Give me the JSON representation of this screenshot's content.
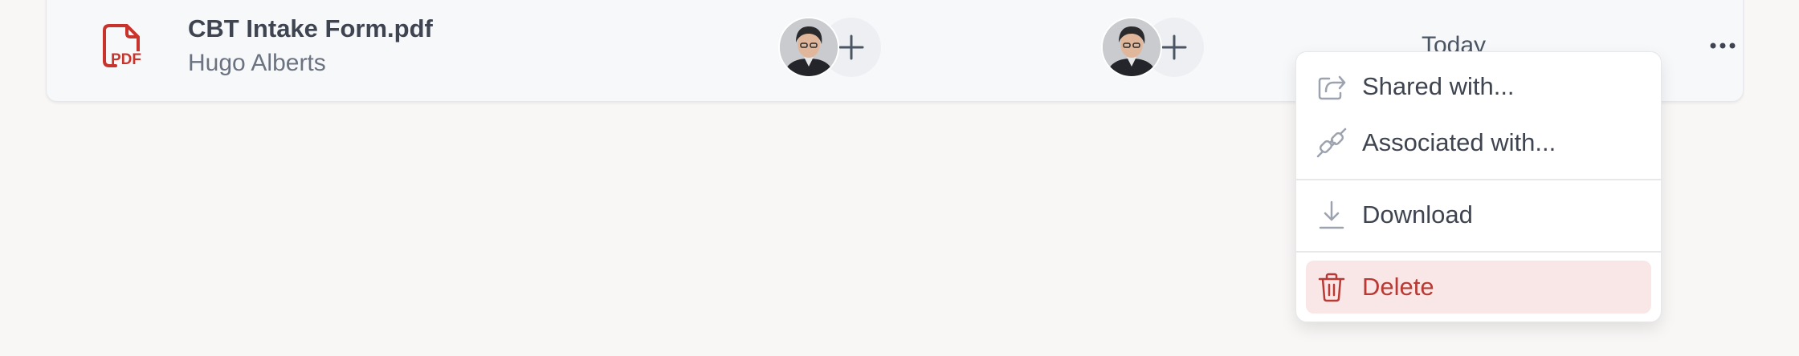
{
  "file_row": {
    "name": "CBT Intake Form.pdf",
    "owner": "Hugo Alberts",
    "date": "Today",
    "file_type_icon": "pdf-icon",
    "shared_with_avatars": 1,
    "associated_with_avatars": 1
  },
  "context_menu": {
    "items": [
      {
        "label": "Shared with...",
        "icon": "share-icon"
      },
      {
        "label": "Associated with...",
        "icon": "link-icon"
      },
      {
        "label": "Download",
        "icon": "download-icon"
      },
      {
        "label": "Delete",
        "icon": "trash-icon",
        "danger": true
      }
    ]
  },
  "colors": {
    "pdf_red": "#c8342c",
    "danger_bg": "#f9e6e6",
    "danger_text": "#b93a34",
    "page_bg": "#f8f7f6"
  }
}
